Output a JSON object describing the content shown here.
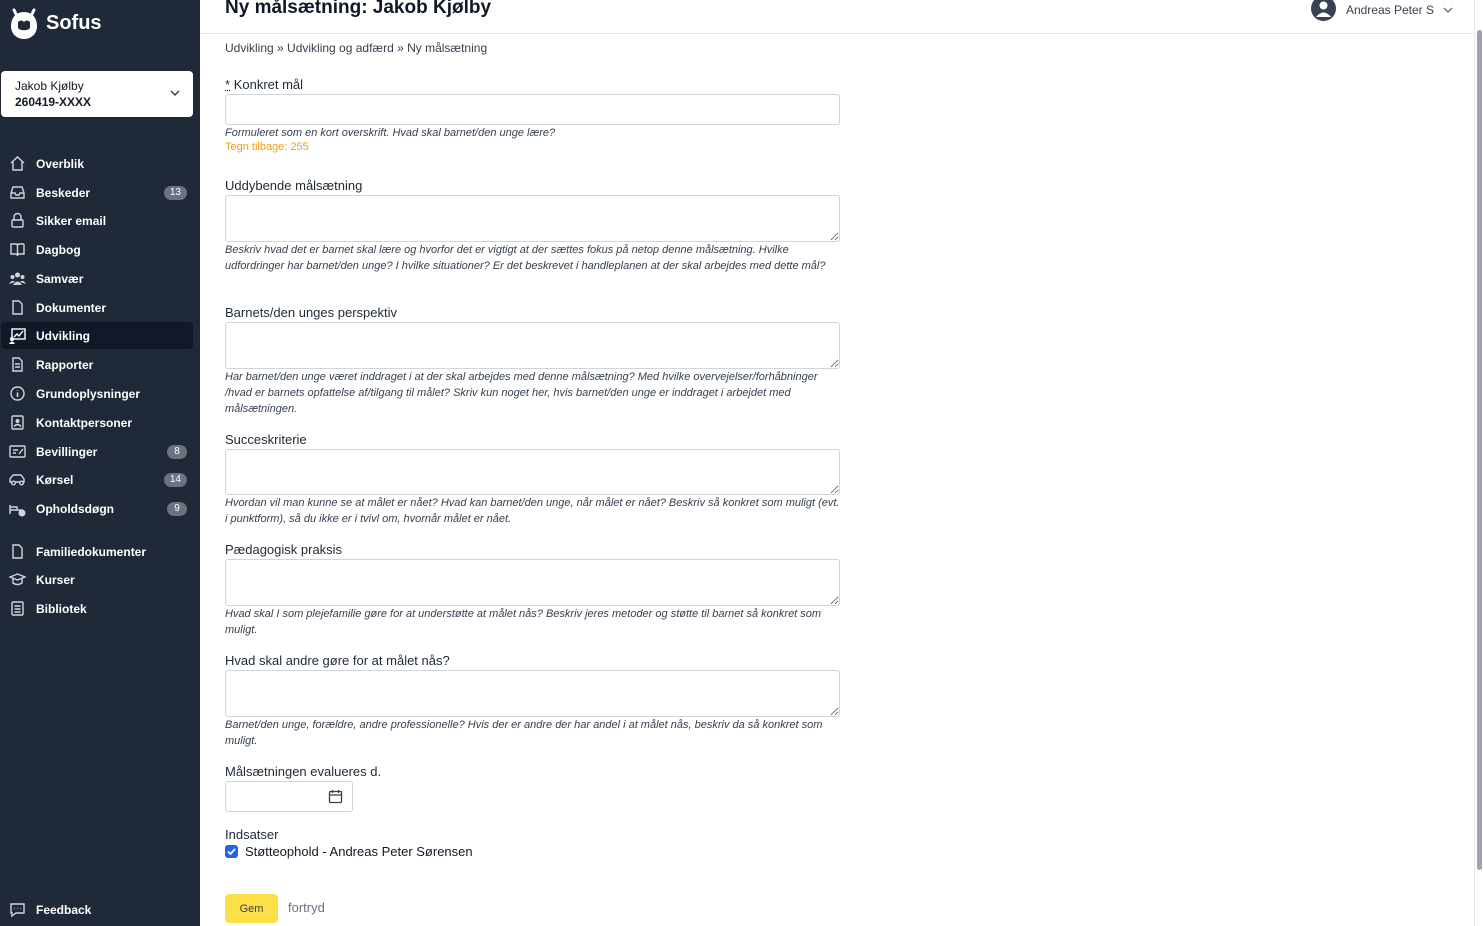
{
  "app": {
    "name": "Sofus"
  },
  "child": {
    "name": "Jakob Kjølby",
    "cpr": "260419-XXXX"
  },
  "nav": [
    {
      "label": "Overblik",
      "icon": "home-icon"
    },
    {
      "label": "Besked​er",
      "icon": "inbox-icon",
      "badge": "13"
    },
    {
      "label": "Sikker email",
      "icon": "lock-icon"
    },
    {
      "label": "Dagbog",
      "icon": "book-icon"
    },
    {
      "label": "Samvær",
      "icon": "users-icon"
    },
    {
      "label": "Dokumenter",
      "icon": "document-icon"
    },
    {
      "label": "Udvikling",
      "icon": "development-icon",
      "active": true
    },
    {
      "label": "Rapporter",
      "icon": "report-icon"
    },
    {
      "label": "Grundoplysninger",
      "icon": "info-icon"
    },
    {
      "label": "Kontaktpersoner",
      "icon": "contact-icon"
    },
    {
      "label": "Bevillinger",
      "icon": "grant-icon",
      "badge": "8"
    },
    {
      "label": "Kørsel",
      "icon": "car-icon",
      "badge": "14"
    },
    {
      "label": "Opholdsdøgn",
      "icon": "bed-icon",
      "badge": "9"
    }
  ],
  "nav_bottom": [
    {
      "label": "Familiedokumenter",
      "icon": "family-document-icon"
    },
    {
      "label": "Kurser",
      "icon": "graduation-cap-icon"
    },
    {
      "label": "Bibliotek",
      "icon": "library-icon"
    }
  ],
  "feedback": {
    "label": "Feedback"
  },
  "header": {
    "title": "Ny målsætning: Jakob Kjølby",
    "user": "Andreas Peter S"
  },
  "breadcrumb": "Udvikling » Udvikling og adfærd » Ny målsætning",
  "form": {
    "required_mark": "*",
    "goal": {
      "label": "Konkret mål",
      "help": "Formuleret som en kort overskrift. Hvad skal barnet/den unge lære?",
      "counter": "Tegn tilbage: 255"
    },
    "detailed": {
      "label": "Uddybende målsætning",
      "help": "Beskriv hvad det er barnet skal lære og hvorfor det er vigtigt at der sættes fokus på netop denne målsætning. Hvilke udfordringer har barnet/den unge? I hvilke situationer? Er det beskrevet i handleplanen at der skal arbejdes med dette mål?"
    },
    "perspective": {
      "label": "Barnets/den unges perspektiv",
      "help": "Har barnet/den unge været inddraget i at der skal arbejdes med denne målsætning? Med hvilke overvejelser/forhåbninger /hvad er barnets opfattelse af/tilgang til målet? Skriv kun noget her, hvis barnet/den unge er inddraget i arbejdet med målsætningen."
    },
    "success": {
      "label": "Succeskriterie",
      "help": "Hvordan vil man kunne se at målet er nået? Hvad kan barnet/den unge, når målet er nået? Beskriv så konkret som muligt (evt. i punktform), så du ikke er i tvivl om, hvornår målet er nået."
    },
    "practice": {
      "label": "Pædagogisk praksis",
      "help": "Hvad skal I som plejefamilie gøre for at understøtte at målet nås? Beskriv jeres metoder og støtte til barnet så konkret som muligt."
    },
    "others": {
      "label": "Hvad skal andre gøre for at målet nås?",
      "help": "Barnet/den unge, forældre, andre professionelle? Hvis der er andre der har andel i at målet nås, beskriv da så konkret som muligt."
    },
    "evaluation": {
      "label": "Målsætningen evalueres d.",
      "value": ""
    },
    "efforts": {
      "label": "Indsatser",
      "option": "Støtteophold - Andreas Peter Sørensen",
      "checked": true
    },
    "save_label": "Gem",
    "cancel_label": "fortryd"
  }
}
